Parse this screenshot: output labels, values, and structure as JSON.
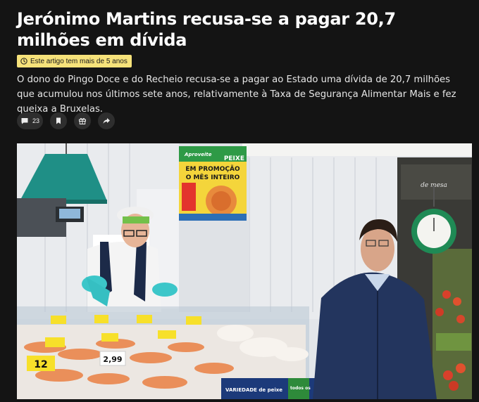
{
  "article": {
    "headline": "Jerónimo Martins recusa-se a pagar 20,7 milhões em dívida",
    "age_notice": "Este artigo tem mais de 5 anos",
    "lead": "O dono do Pingo Doce e do Recheio recusa-se a pagar ao Estado uma dívida de 20,7 milhões que acumulou nos últimos sete anos, relativamente à Taxa de Segurança Alimentar Mais e fez queixa a Bruxelas."
  },
  "actions": {
    "comments_count": "23",
    "icons": [
      "comment-icon",
      "bookmark-icon",
      "gift-icon",
      "share-icon"
    ]
  },
  "photo": {
    "promo_sign": {
      "top": "Aproveite",
      "category": "PEIXE",
      "line1": "EM PROMOÇÃO",
      "line2": "O MÊS INTEIRO"
    },
    "store_sign": "de mesa",
    "price_tags": [
      "12",
      "2,99"
    ],
    "counter_banner": "VARIEDADE de peixe",
    "counter_banner_right": "todos os"
  },
  "colors": {
    "background": "#141414",
    "badge": "#f6e27a",
    "action_bg": "#2e2e2e"
  }
}
